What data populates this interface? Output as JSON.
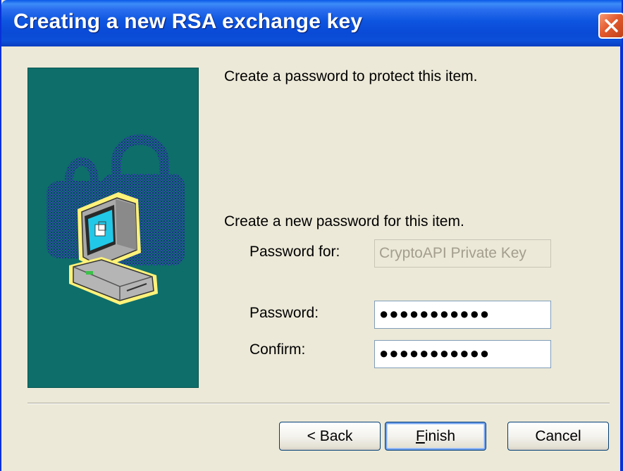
{
  "window": {
    "title": "Creating a new RSA exchange key",
    "close_icon": "close-icon"
  },
  "panel": {
    "illustration": "locked-computer-icon",
    "background_color": "#0E6E6A"
  },
  "instruction": "Create a password to protect this item.",
  "sub_instruction": "Create a new password for this item.",
  "form": {
    "password_for_label": "Password for:",
    "password_for_value": "CryptoAPI Private Key",
    "password_label": "Password:",
    "password_value": "●●●●●●●●●●●",
    "confirm_label": "Confirm:",
    "confirm_value": "●●●●●●●●●●●"
  },
  "buttons": {
    "back_label": "< Back",
    "finish_mnemonic": "F",
    "finish_rest": "inish",
    "cancel_label": "Cancel"
  },
  "colors": {
    "titlebar": "#0A4AD6",
    "dialog_background": "#ECE9D8",
    "close_button": "#E45A2E"
  }
}
